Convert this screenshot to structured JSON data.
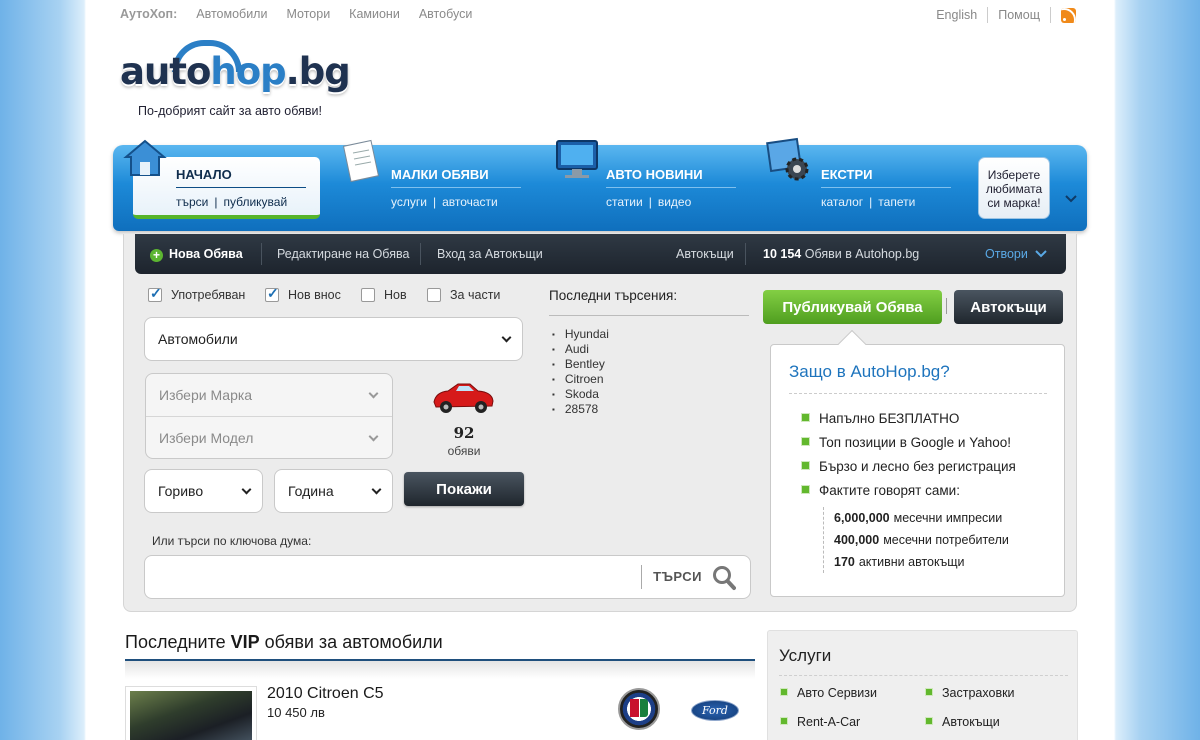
{
  "topbar": {
    "label": "АутоХоп:",
    "links": [
      "Автомобили",
      "Мотори",
      "Камиони",
      "Автобуси"
    ],
    "english": "English",
    "help": "Помощ",
    "rss_icon": "rss-icon"
  },
  "logo": {
    "text_a": "auto",
    "text_b": "hop",
    "text_c": ".bg"
  },
  "tagline": "По-добрият сайт за авто обяви!",
  "nav": {
    "home": {
      "title": "НАЧАЛО",
      "sub1": "търси",
      "sub2": "публикувай"
    },
    "classifieds": {
      "title": "МАЛКИ ОБЯВИ",
      "sub1": "услуги",
      "sub2": "авточасти"
    },
    "news": {
      "title": "АВТО НОВИНИ",
      "sub1": "статии",
      "sub2": "видео"
    },
    "extras": {
      "title": "ЕКСТРИ",
      "sub1": "каталог",
      "sub2": "тапети"
    },
    "brand_box": "Изберете любимата си марка!"
  },
  "strip": {
    "new_ad": "Нова Обява",
    "edit_ad": "Редактиране на Обява",
    "dealer_login": "Вход за Автокъщи",
    "dealers": "Автокъщи",
    "ads_count": "10 154",
    "ads_text": "Обяви в Autohop.bg",
    "open": "Отвори"
  },
  "search": {
    "checkboxes": [
      {
        "label": "Употребяван",
        "checked": true
      },
      {
        "label": "Нов внос",
        "checked": true
      },
      {
        "label": "Нов",
        "checked": false
      },
      {
        "label": "За части",
        "checked": false
      }
    ],
    "category": "Автомобили",
    "make_placeholder": "Избери Марка",
    "model_placeholder": "Избери Модел",
    "fuel": "Гориво",
    "year": "Година",
    "count": "92",
    "count_unit": "обяви",
    "show_button": "Покажи",
    "keyword_label": "Или търси по ключова дума:",
    "keyword_value": "",
    "search_button": "ТЪРСИ"
  },
  "recent": {
    "title": "Последни търсения:",
    "items": [
      "Hyundai",
      "Audi",
      "Bentley",
      "Citroen",
      "Skoda",
      "28578"
    ]
  },
  "cta": {
    "publish": "Публикувай Обява",
    "dealers": "Автокъщи"
  },
  "why": {
    "title": "Защо в AutoHop.bg?",
    "items": [
      "Напълно БЕЗПЛАТНО",
      "Топ позиции в Google и Yahoo!",
      "Бързо и лесно без регистрация",
      "Фактите говорят сами:"
    ],
    "stats": [
      {
        "value": "6,000,000",
        "label": "месечни импресии"
      },
      {
        "value": "400,000",
        "label": "месечни потребители"
      },
      {
        "value": "170",
        "label": "активни автокъщи"
      }
    ]
  },
  "vip": {
    "title_pre": "Последните ",
    "title_bold": "VIP",
    "title_post": " обяви за автомобили",
    "listing": {
      "name": "2010 Citroen C5",
      "price": "10 450 лв"
    },
    "ford_text": "Ford"
  },
  "services": {
    "title": "Услуги",
    "items": [
      "Авто Сервизи",
      "Застраховки",
      "Rent-A-Car",
      "Автокъщи"
    ]
  },
  "colors": {
    "accent_blue": "#1e74bd",
    "green": "#62b82d",
    "dark": "#1d242d"
  }
}
